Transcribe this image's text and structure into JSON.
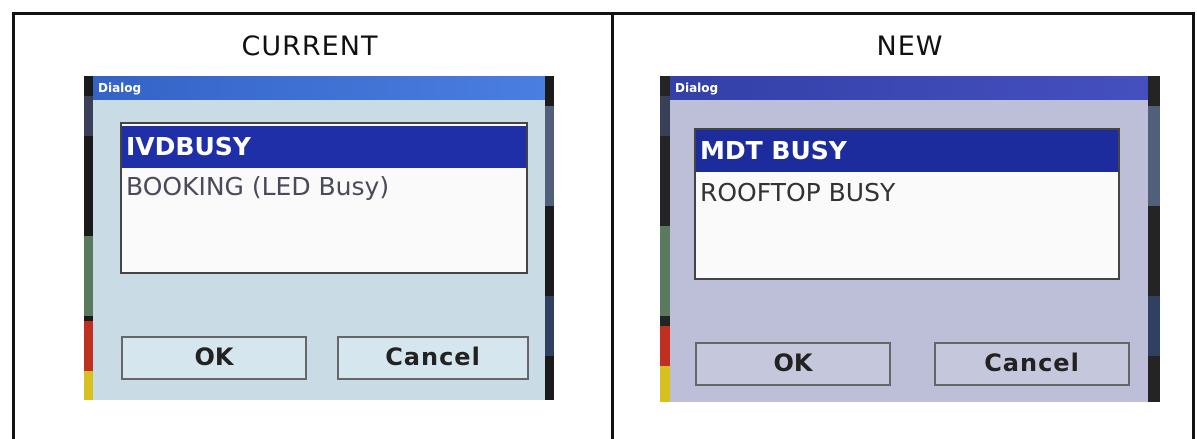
{
  "columns": {
    "current": {
      "heading": "CURRENT",
      "dialog": {
        "title": "Dialog",
        "items": [
          "IVDBUSY",
          "BOOKING (LED Busy)"
        ],
        "selected_index": 0,
        "ok_label": "OK",
        "cancel_label": "Cancel"
      }
    },
    "new": {
      "heading": "NEW",
      "dialog": {
        "title": "Dialog",
        "items": [
          "MDT BUSY",
          "ROOFTOP BUSY"
        ],
        "selected_index": 0,
        "ok_label": "OK",
        "cancel_label": "Cancel"
      }
    }
  },
  "colors": {
    "selection": "#1e2fa8",
    "title_bar": "#3f6fd4",
    "current_dialog_bg": "#c9dce6",
    "new_dialog_bg": "#bdbfd9"
  }
}
